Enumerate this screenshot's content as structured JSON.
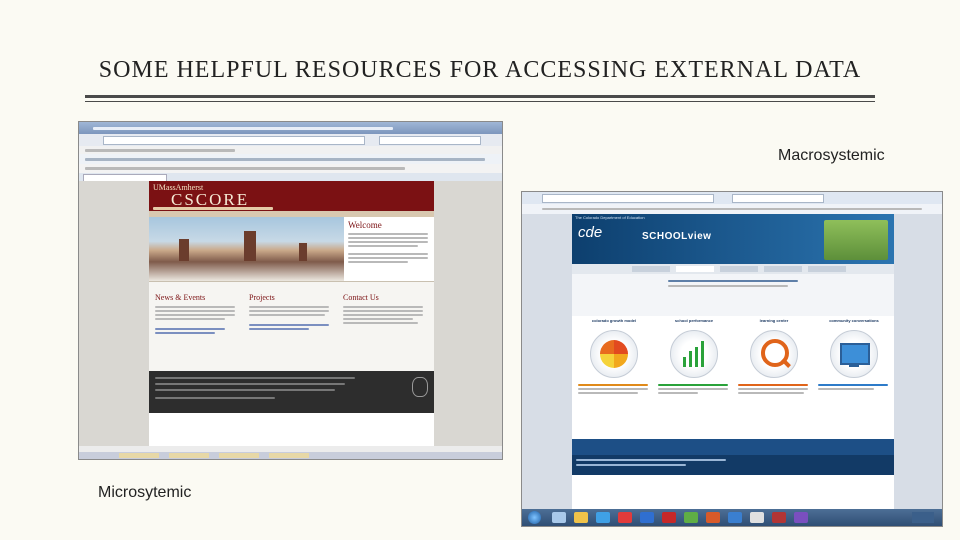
{
  "slide": {
    "title": "SOME HELPFUL RESOURCES FOR ACCESSING EXTERNAL DATA",
    "caption_macro": "Macrosystemic",
    "caption_micro": "Microsytemic"
  },
  "left_screenshot": {
    "site_header": "UMassAmherst",
    "logo": "CSCORE",
    "welcome": "Welcome",
    "sections": [
      "News & Events",
      "Projects",
      "Contact Us"
    ]
  },
  "right_screenshot": {
    "header_small": "The Colorado Department of Education",
    "brand_cde": "cde",
    "brand_schoolview": "SCHOOLview",
    "columns": [
      "colorado growth model",
      "school performance",
      "learning center",
      "community conversations"
    ]
  },
  "colors": {
    "umass_maroon": "#7b1113",
    "schoolview_blue": "#1d4f86",
    "slide_background": "#fbfaf3"
  }
}
